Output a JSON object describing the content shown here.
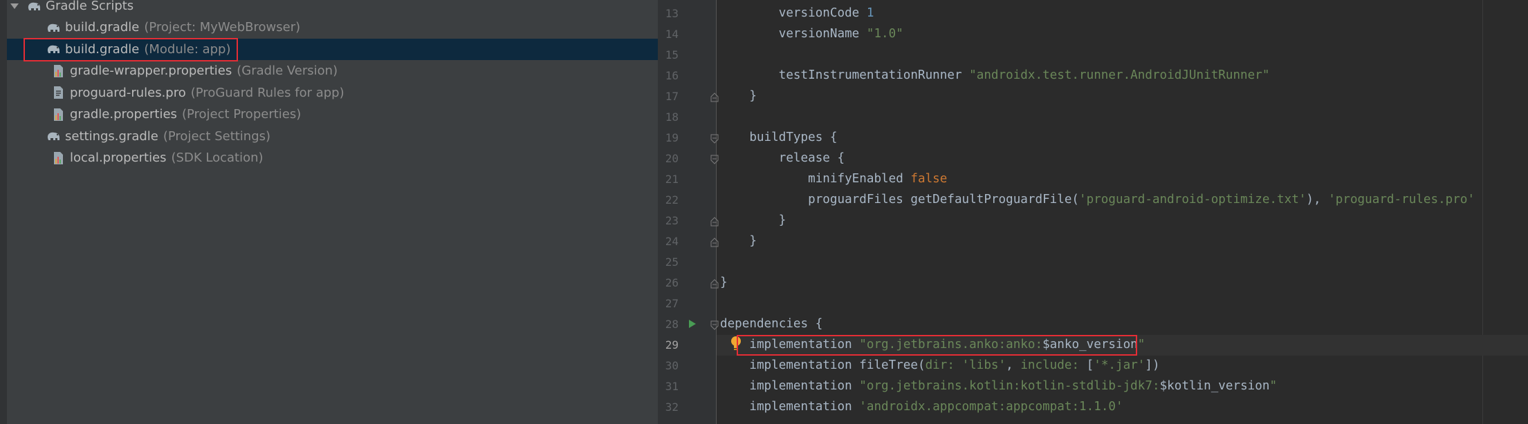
{
  "tree": {
    "folder_label": "Gradle Scripts",
    "items": [
      {
        "name": "build.gradle",
        "detail": "(Project: MyWebBrowser)",
        "icon": "gradle-elephant-icon"
      },
      {
        "name": "build.gradle",
        "detail": "(Module: app)",
        "icon": "gradle-elephant-icon",
        "selected": true
      },
      {
        "name": "gradle-wrapper.properties",
        "detail": "(Gradle Version)",
        "icon": "properties-file-icon"
      },
      {
        "name": "proguard-rules.pro",
        "detail": "(ProGuard Rules for app)",
        "icon": "text-file-icon"
      },
      {
        "name": "gradle.properties",
        "detail": "(Project Properties)",
        "icon": "properties-file-icon"
      },
      {
        "name": "settings.gradle",
        "detail": "(Project Settings)",
        "icon": "gradle-elephant-icon"
      },
      {
        "name": "local.properties",
        "detail": "(SDK Location)",
        "icon": "properties-file-icon"
      }
    ]
  },
  "editor": {
    "active_line": "29",
    "lines": [
      {
        "n": "13",
        "parts": [
          [
            "ident",
            "        versionCode "
          ],
          [
            "num-lit",
            "1"
          ]
        ]
      },
      {
        "n": "14",
        "parts": [
          [
            "ident",
            "        versionName "
          ],
          [
            "str",
            "\"1.0\""
          ]
        ]
      },
      {
        "n": "15",
        "parts": []
      },
      {
        "n": "16",
        "parts": [
          [
            "ident",
            "        testInstrumentationRunner "
          ],
          [
            "str",
            "\"androidx.test.runner.AndroidJUnitRunner\""
          ]
        ]
      },
      {
        "n": "17",
        "parts": [
          [
            "ident",
            "    }"
          ]
        ]
      },
      {
        "n": "18",
        "parts": []
      },
      {
        "n": "19",
        "parts": [
          [
            "ident",
            "    buildTypes {"
          ]
        ]
      },
      {
        "n": "20",
        "parts": [
          [
            "ident",
            "        release {"
          ]
        ]
      },
      {
        "n": "21",
        "parts": [
          [
            "ident",
            "            minifyEnabled "
          ],
          [
            "kw",
            "false"
          ]
        ]
      },
      {
        "n": "22",
        "parts": [
          [
            "ident",
            "            proguardFiles getDefaultProguardFile("
          ],
          [
            "str",
            "'proguard-android-optimize.txt'"
          ],
          [
            "ident",
            "), "
          ],
          [
            "str",
            "'proguard-rules.pro'"
          ]
        ]
      },
      {
        "n": "23",
        "parts": [
          [
            "ident",
            "        }"
          ]
        ]
      },
      {
        "n": "24",
        "parts": [
          [
            "ident",
            "    }"
          ]
        ]
      },
      {
        "n": "25",
        "parts": []
      },
      {
        "n": "26",
        "parts": [
          [
            "ident",
            "}"
          ]
        ]
      },
      {
        "n": "27",
        "parts": []
      },
      {
        "n": "28",
        "parts": [
          [
            "ident",
            "dependencies {"
          ]
        ]
      },
      {
        "n": "29",
        "parts": [
          [
            "ident",
            "    implementation "
          ],
          [
            "str",
            "\"org.jetbrains.anko:anko:"
          ],
          [
            "ident",
            "$anko_version"
          ],
          [
            "str",
            "\""
          ]
        ]
      },
      {
        "n": "30",
        "parts": [
          [
            "ident",
            "    implementation fileTree("
          ],
          [
            "str",
            "dir: "
          ],
          [
            "str",
            "'libs'"
          ],
          [
            "ident",
            ", "
          ],
          [
            "str",
            "include: "
          ],
          [
            "ident",
            "["
          ],
          [
            "str",
            "'*.jar'"
          ],
          [
            "ident",
            "])"
          ]
        ]
      },
      {
        "n": "31",
        "parts": [
          [
            "ident",
            "    implementation "
          ],
          [
            "str",
            "\"org.jetbrains.kotlin:kotlin-stdlib-jdk7:"
          ],
          [
            "ident",
            "$kotlin_version"
          ],
          [
            "str",
            "\""
          ]
        ]
      },
      {
        "n": "32",
        "parts": [
          [
            "ident",
            "    implementation "
          ],
          [
            "str",
            "'androidx.appcompat:appcompat:1.1.0'"
          ]
        ]
      }
    ]
  },
  "colors": {
    "tree_bg": "#3c3f41",
    "selection": "#0d293e",
    "editor_bg": "#2b2b2b",
    "string": "#6a8759",
    "keyword": "#cc7832",
    "number": "#6897bb",
    "callout_red": "#e52d35"
  }
}
